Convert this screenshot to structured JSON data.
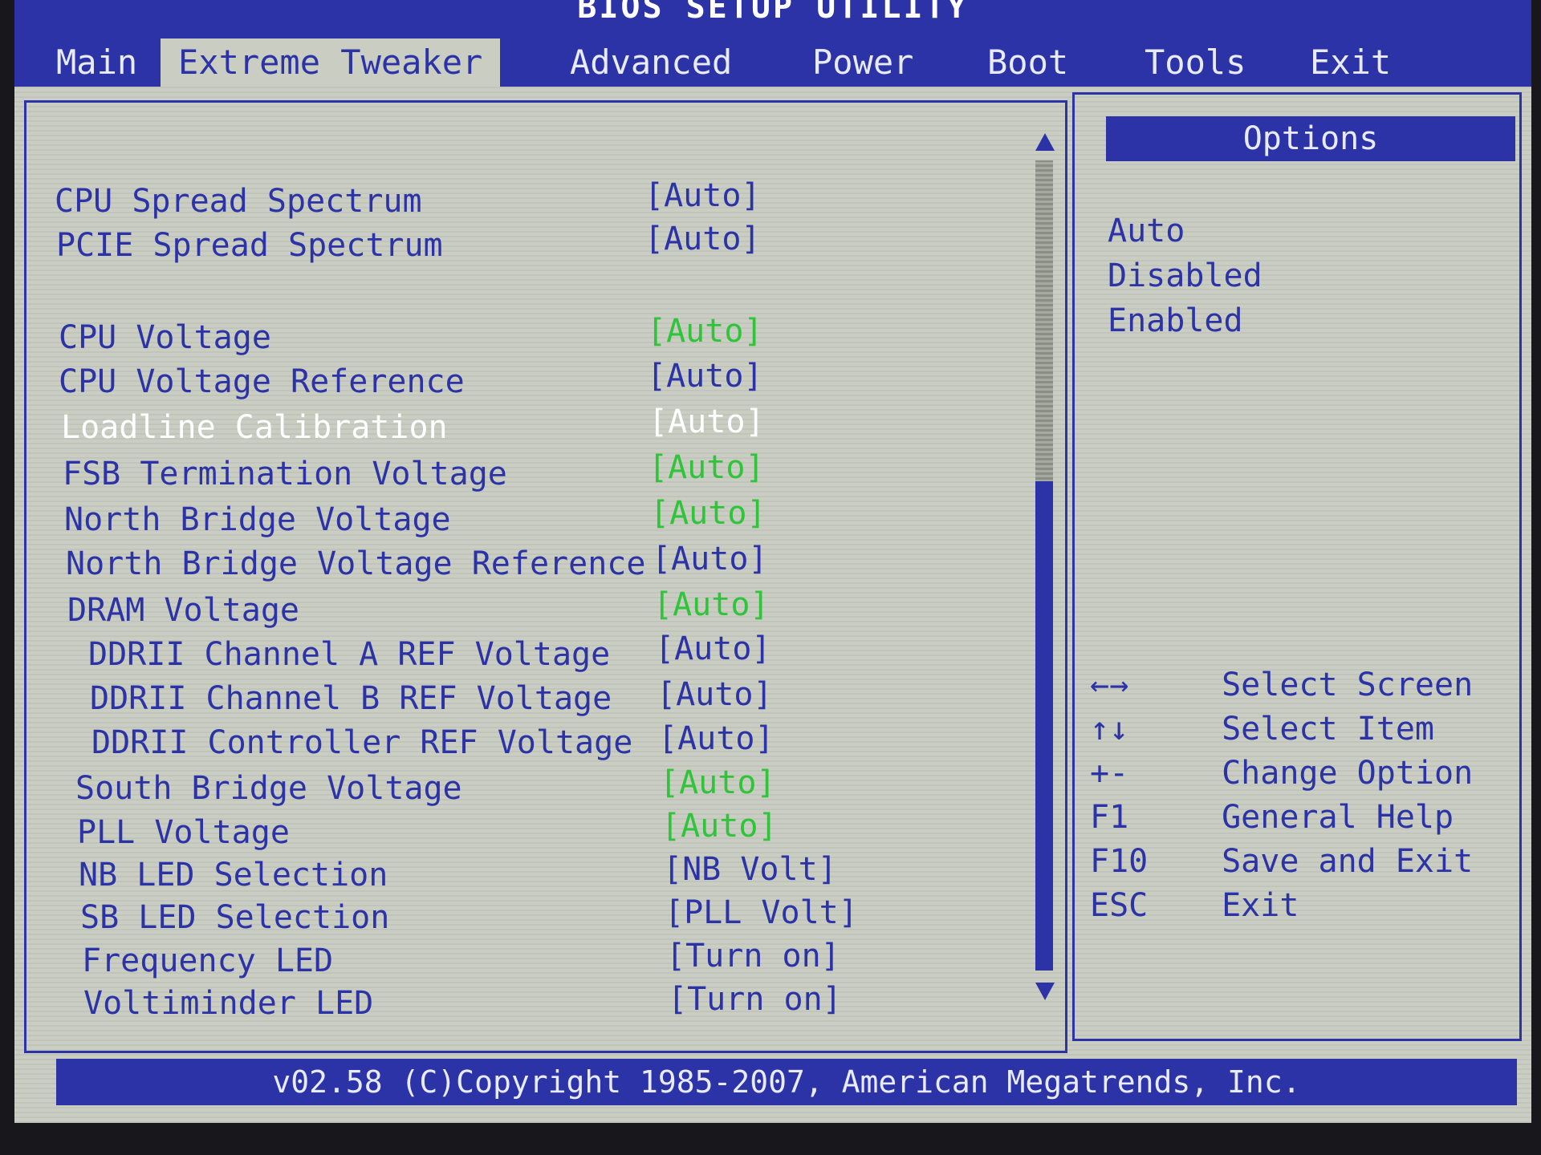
{
  "title": "BIOS SETUP UTILITY",
  "tabs": [
    {
      "label": "Main"
    },
    {
      "label": "Extreme Tweaker"
    },
    {
      "label": "Advanced"
    },
    {
      "label": "Power"
    },
    {
      "label": "Boot"
    },
    {
      "label": "Tools"
    },
    {
      "label": "Exit"
    }
  ],
  "settings": [
    {
      "label": "CPU Spread Spectrum",
      "value": "[Auto]"
    },
    {
      "label": "PCIE Spread Spectrum",
      "value": "[Auto]"
    },
    {
      "label": "CPU Voltage",
      "value": "[Auto]"
    },
    {
      "label": "CPU Voltage Reference",
      "value": "[Auto]"
    },
    {
      "label": "Loadline Calibration",
      "value": "[Auto]"
    },
    {
      "label": "FSB Termination Voltage",
      "value": "[Auto]"
    },
    {
      "label": "North Bridge Voltage",
      "value": "[Auto]"
    },
    {
      "label": "North Bridge Voltage Reference",
      "value": "[Auto]"
    },
    {
      "label": "DRAM Voltage",
      "value": "[Auto]"
    },
    {
      "label": "DDRII Channel A REF Voltage",
      "value": "[Auto]"
    },
    {
      "label": "DDRII Channel B REF Voltage",
      "value": "[Auto]"
    },
    {
      "label": "DDRII Controller REF Voltage",
      "value": "[Auto]"
    },
    {
      "label": "South Bridge Voltage",
      "value": "[Auto]"
    },
    {
      "label": "PLL Voltage",
      "value": "[Auto]"
    },
    {
      "label": "NB LED Selection",
      "value": "[NB Volt]"
    },
    {
      "label": "SB LED Selection",
      "value": "[PLL Volt]"
    },
    {
      "label": "Frequency LED",
      "value": "[Turn on]"
    },
    {
      "label": "Voltiminder LED",
      "value": "[Turn on]"
    }
  ],
  "options": {
    "header": "Options",
    "items": [
      "Auto",
      "Disabled",
      "Enabled"
    ]
  },
  "help": [
    {
      "key": "←→",
      "desc": "Select Screen"
    },
    {
      "key": "↑↓",
      "desc": "Select Item"
    },
    {
      "key": "+-",
      "desc": "Change Option"
    },
    {
      "key": "F1",
      "desc": "General Help"
    },
    {
      "key": "F10",
      "desc": "Save and Exit"
    },
    {
      "key": "ESC",
      "desc": "Exit"
    }
  ],
  "footer": "v02.58 (C)Copyright 1985-2007, American Megatrends, Inc.",
  "colors": {
    "bios_blue": "#2c33a6",
    "background": "#c9cdc2",
    "modified_value": "#2fc43a",
    "selected_text": "#ffffff"
  }
}
